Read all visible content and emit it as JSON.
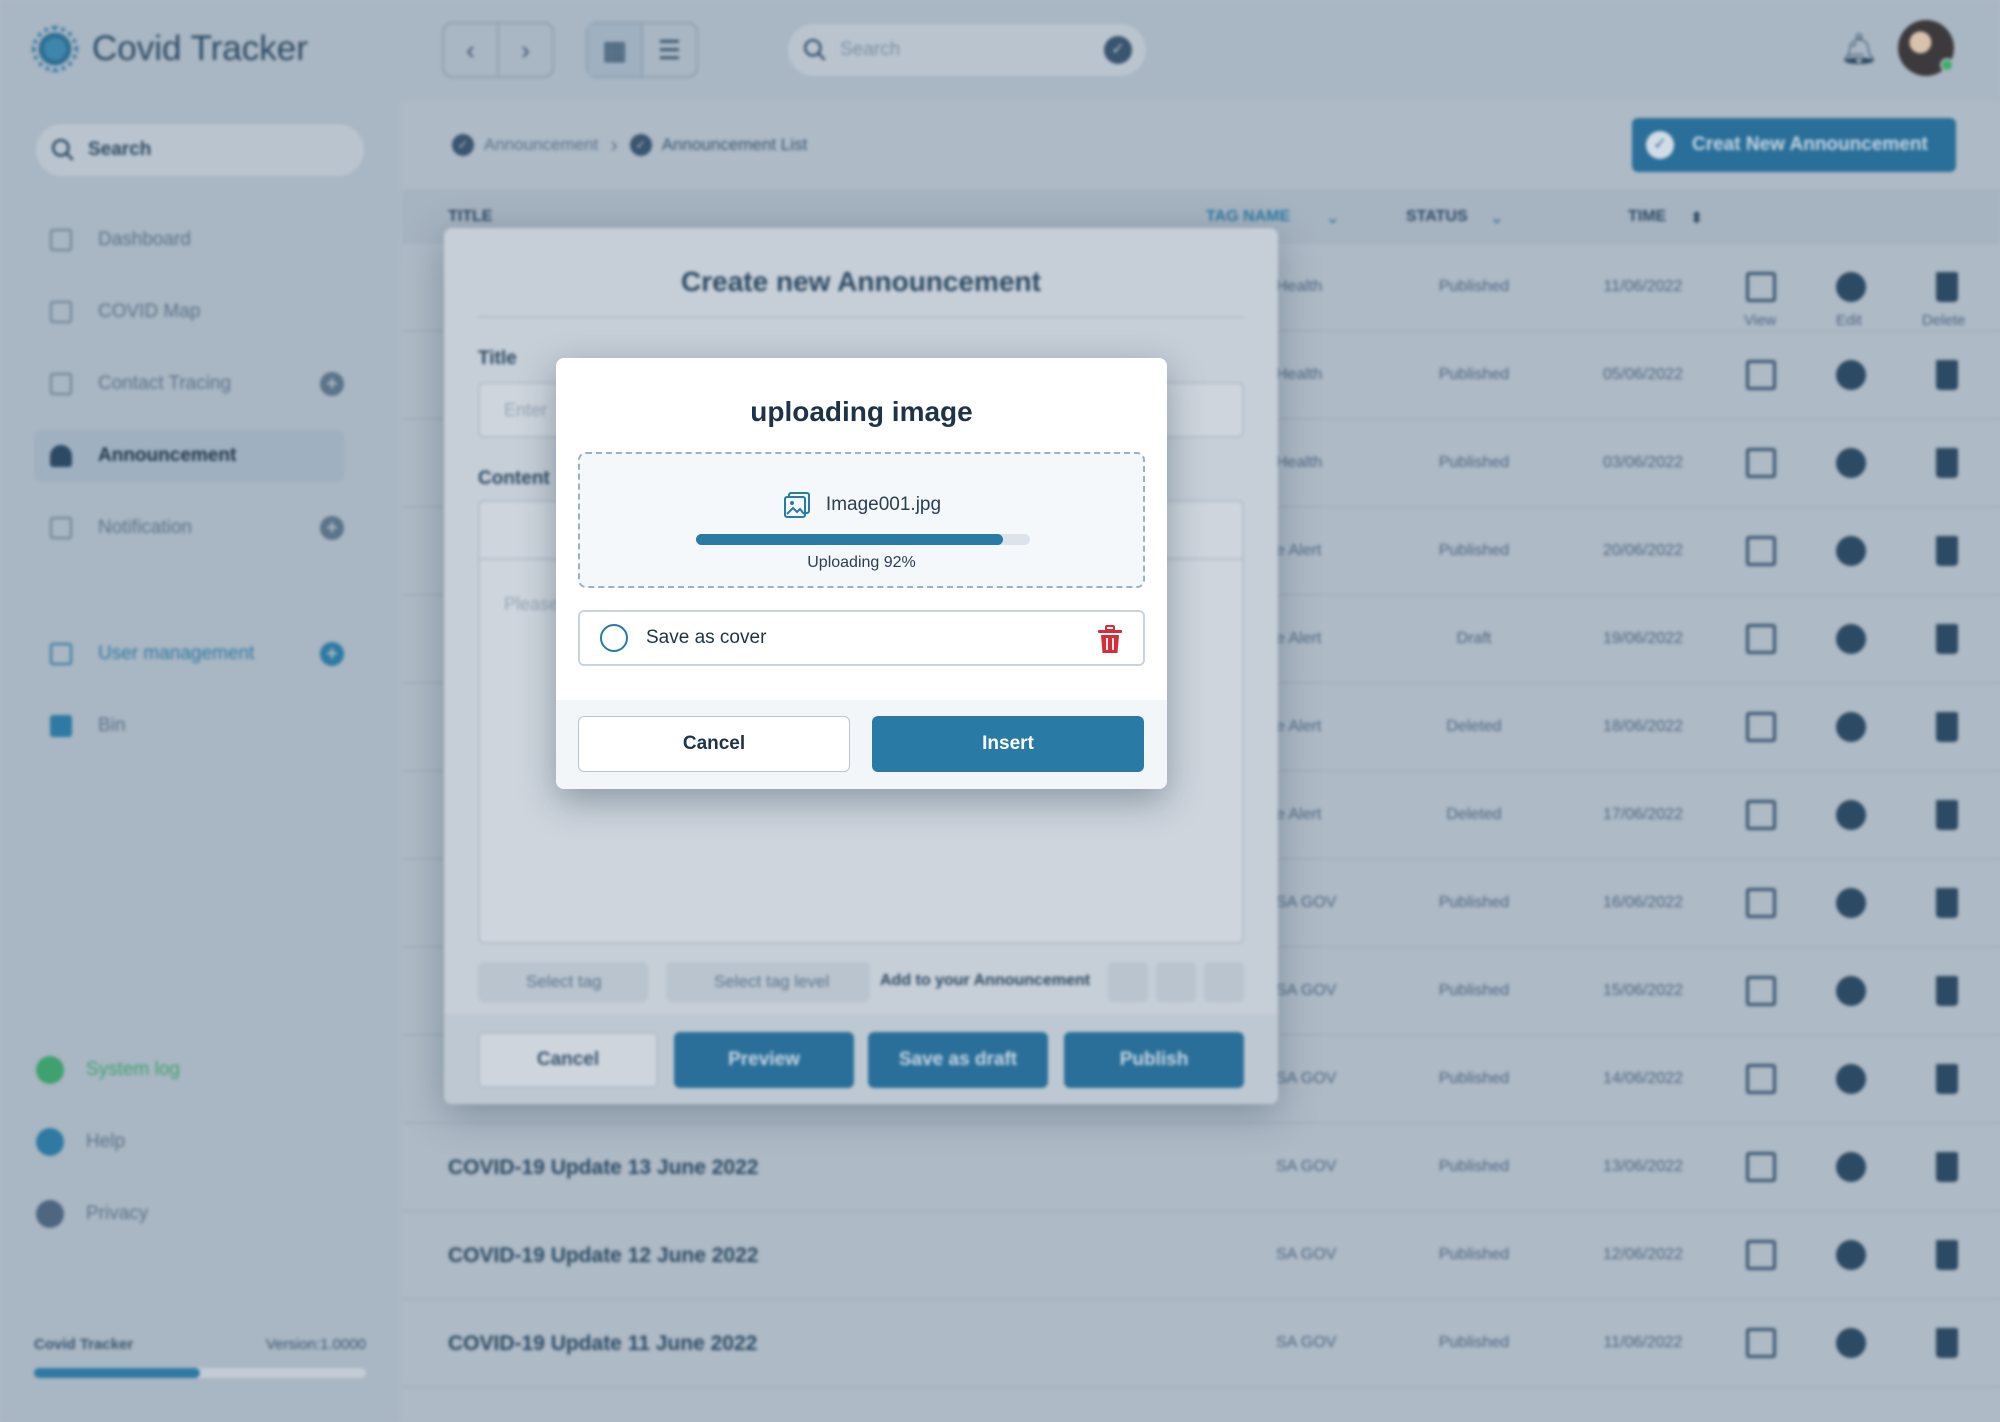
{
  "app": {
    "brand": "Covid Tracker",
    "version_label": "Version:1.0000",
    "footer_brand": "Covid Tracker"
  },
  "sidebar": {
    "search_label": "Search",
    "items": [
      {
        "label": "Dashboard"
      },
      {
        "label": "COVID Map"
      },
      {
        "label": "Contact Tracing"
      },
      {
        "label": "Announcement"
      },
      {
        "label": "Notification"
      },
      {
        "label": "User management"
      },
      {
        "label": "Bin"
      }
    ],
    "footer_links": [
      {
        "label": "System log",
        "color": "#3fa16e"
      },
      {
        "label": "Help",
        "color": "#2f7aa3"
      },
      {
        "label": "Privacy",
        "color": "#4e6680"
      }
    ],
    "storage_progress": 0.5
  },
  "topbar": {
    "search_placeholder": "Search"
  },
  "breadcrumb": {
    "parent": "Announcement",
    "current": "Announcement List"
  },
  "create_button": "Creat New Announcement",
  "table": {
    "headers": {
      "title": "TITLE",
      "tag": "TAG NAME",
      "status": "STATUS",
      "time": "TIME"
    },
    "action_labels": {
      "view": "View",
      "edit": "Edit",
      "delete": "Delete"
    },
    "rows": [
      {
        "title": "",
        "tag": "Health",
        "status": "Published",
        "time": "11/06/2022"
      },
      {
        "title": "",
        "tag": "Health",
        "status": "Published",
        "time": "05/06/2022"
      },
      {
        "title": "",
        "tag": "Health",
        "status": "Published",
        "time": "03/06/2022"
      },
      {
        "title": "",
        "tag": "e Alert",
        "status": "Published",
        "time": "20/06/2022"
      },
      {
        "title": "",
        "tag": "e Alert",
        "status": "Draft",
        "time": "19/06/2022"
      },
      {
        "title": "",
        "tag": "e Alert",
        "status": "Deleted",
        "time": "18/06/2022"
      },
      {
        "title": "",
        "tag": "e Alert",
        "status": "Deleted",
        "time": "17/06/2022"
      },
      {
        "title": "",
        "tag": "SA GOV",
        "status": "Published",
        "time": "16/06/2022"
      },
      {
        "title": "",
        "tag": "SA GOV",
        "status": "Published",
        "time": "15/06/2022"
      },
      {
        "title": "",
        "tag": "SA GOV",
        "status": "Published",
        "time": "14/06/2022"
      },
      {
        "title": "COVID-19 Update 13 June 2022",
        "tag": "SA GOV",
        "status": "Published",
        "time": "13/06/2022"
      },
      {
        "title": "COVID-19 Update 12 June 2022",
        "tag": "SA GOV",
        "status": "Published",
        "time": "12/06/2022"
      },
      {
        "title": "COVID-19 Update 11 June 2022",
        "tag": "SA GOV",
        "status": "Published",
        "time": "11/06/2022"
      }
    ]
  },
  "create_modal": {
    "title": "Create new Announcement",
    "title_label": "Title",
    "title_placeholder": "Enter",
    "content_label": "Content",
    "content_placeholder": "Please",
    "select_tag": "Select tag",
    "select_tag_level": "Select tag level",
    "add_label": "Add to your Announcement",
    "buttons": {
      "cancel": "Cancel",
      "preview": "Preview",
      "draft": "Save as draft",
      "publish": "Publish"
    }
  },
  "upload_modal": {
    "title": "uploading image",
    "file_name": "Image001.jpg",
    "progress": 0.92,
    "status_text": "Uploading 92%",
    "save_as_cover_label": "Save as cover",
    "cancel_label": "Cancel",
    "insert_label": "Insert",
    "colors": {
      "accent": "#2a7aa6",
      "danger": "#d22f3a"
    }
  }
}
